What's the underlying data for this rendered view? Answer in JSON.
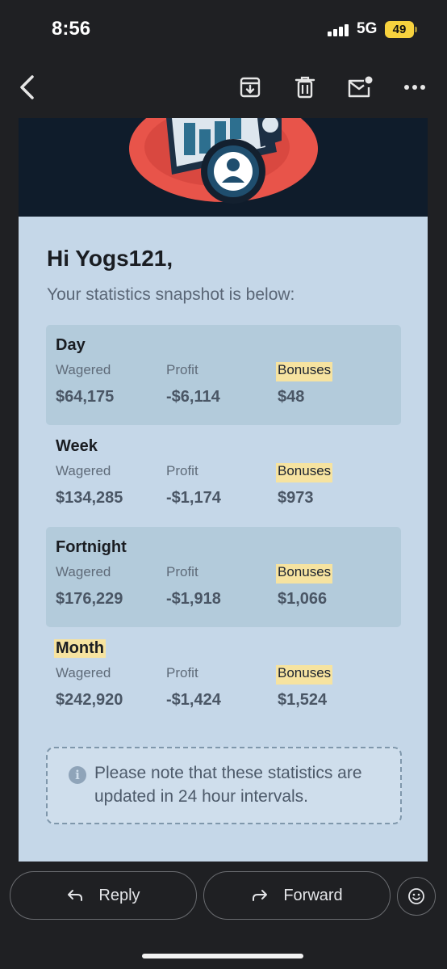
{
  "status": {
    "time": "8:56",
    "network": "5G",
    "battery": "49"
  },
  "toolbar": {
    "back_icon": "chevron-left-icon",
    "archive_icon": "archive-icon",
    "delete_icon": "trash-icon",
    "unread_icon": "mark-unread-icon",
    "more_icon": "more-horizontal-icon"
  },
  "email": {
    "greeting": "Hi Yogs121,",
    "intro": "Your statistics snapshot is below:",
    "periods": [
      {
        "title": "Day",
        "wagered_label": "Wagered",
        "profit_label": "Profit",
        "bonuses_label": "Bonuses",
        "wagered": "$64,175",
        "profit": "-$6,114",
        "bonuses": "$48"
      },
      {
        "title": "Week",
        "wagered_label": "Wagered",
        "profit_label": "Profit",
        "bonuses_label": "Bonuses",
        "wagered": "$134,285",
        "profit": "-$1,174",
        "bonuses": "$973"
      },
      {
        "title": "Fortnight",
        "wagered_label": "Wagered",
        "profit_label": "Profit",
        "bonuses_label": "Bonuses",
        "wagered": "$176,229",
        "profit": "-$1,918",
        "bonuses": "$1,066"
      },
      {
        "title": "Month",
        "wagered_label": "Wagered",
        "profit_label": "Profit",
        "bonuses_label": "Bonuses",
        "wagered": "$242,920",
        "profit": "-$1,424",
        "bonuses": "$1,524"
      }
    ],
    "notice": "Please note that these statistics are updated in 24 hour intervals."
  },
  "actions": {
    "reply": "Reply",
    "forward": "Forward",
    "emoji_icon": "emoji-reaction-icon"
  },
  "colors": {
    "email_bg": "#c5d7e8",
    "shaded_row": "#b3cbdb",
    "highlight": "#f6e3a0",
    "hero_bg": "#0f1c2b"
  }
}
